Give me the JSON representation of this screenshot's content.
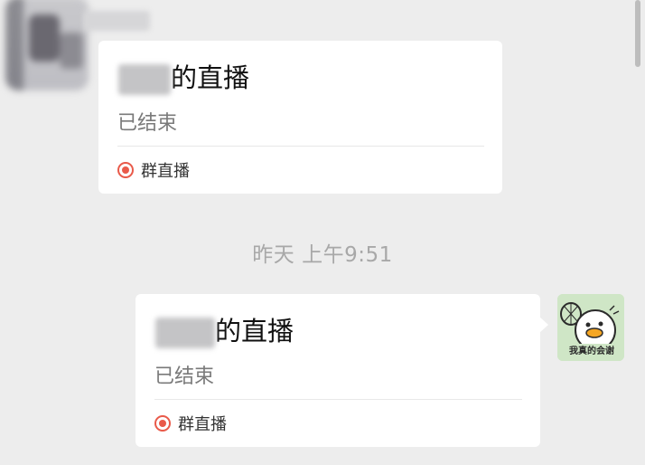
{
  "colors": {
    "background": "#ededed",
    "card": "#ffffff",
    "live_accent": "#e95a4a",
    "timestamp_text": "#a8a8a8"
  },
  "messages": [
    {
      "title_suffix": "的直播",
      "status": "已结束",
      "footer_label": "群直播",
      "footer_icon": "live-record-icon"
    },
    {
      "title_suffix": "的直播",
      "status": "已结束",
      "footer_label": "群直播",
      "footer_icon": "live-record-icon"
    }
  ],
  "timestamp": "昨天 上午9:51",
  "right_avatar": {
    "icon": "duck-sticker-avatar",
    "caption": "我真的会谢"
  }
}
